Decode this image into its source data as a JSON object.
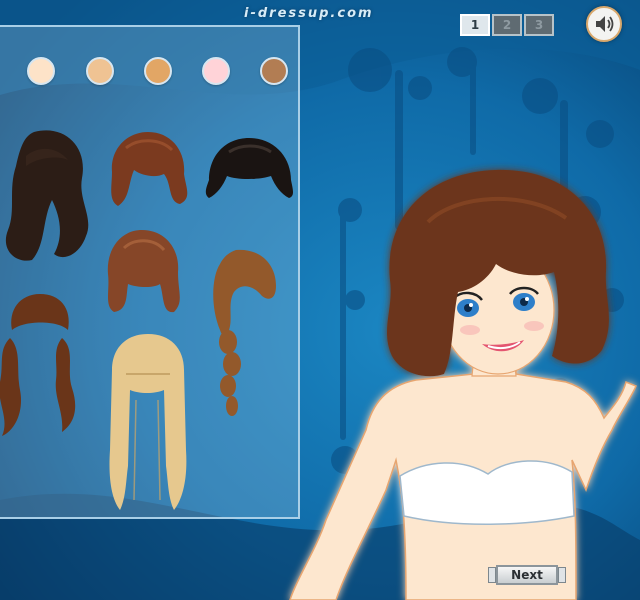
{
  "site": {
    "title": "i-dressup.com"
  },
  "pages": [
    {
      "label": "1",
      "active": true
    },
    {
      "label": "2",
      "active": false
    },
    {
      "label": "3",
      "active": false
    }
  ],
  "sound": {
    "icon": "speaker-icon"
  },
  "skin_tones": [
    {
      "name": "skin-tone-fair",
      "color": "#fde3c8"
    },
    {
      "name": "skin-tone-light",
      "color": "#efc393"
    },
    {
      "name": "skin-tone-tan",
      "color": "#e2a665"
    },
    {
      "name": "skin-tone-pink",
      "color": "#ffd3d8"
    },
    {
      "name": "skin-tone-brown",
      "color": "#b27d53"
    }
  ],
  "hairstyles": [
    {
      "name": "hairstyle-long-black-wavy",
      "color": "#2c1d16"
    },
    {
      "name": "hairstyle-auburn-bob",
      "color": "#7b3a1f"
    },
    {
      "name": "hairstyle-black-bangs-bob",
      "color": "#1a1412"
    },
    {
      "name": "hairstyle-auburn-shoulder",
      "color": "#864628"
    },
    {
      "name": "hairstyle-brown-braid",
      "color": "#93592b"
    },
    {
      "name": "hairstyle-brown-pigtails",
      "color": "#6a3519"
    },
    {
      "name": "hairstyle-blonde-long-straight",
      "color": "#e6c88e"
    }
  ],
  "model": {
    "hair_color": "#6c351a",
    "skin_color": "#fde7cf",
    "top_color": "#ffffff"
  },
  "next_button": {
    "label": "Next"
  }
}
